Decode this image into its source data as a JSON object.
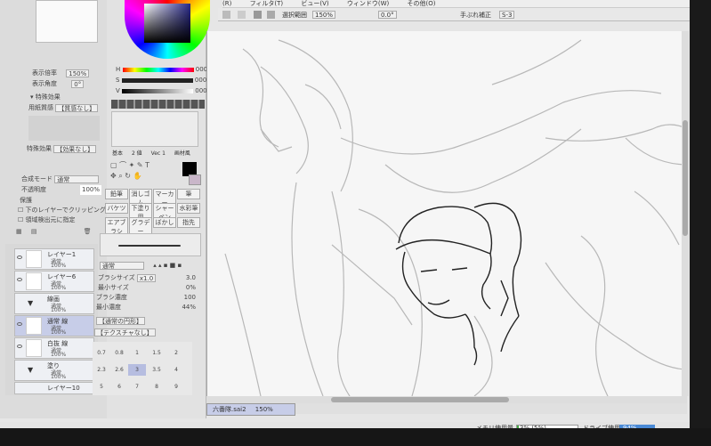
{
  "menu": {
    "items": [
      "フィルタ(T)",
      "ビュー(V)",
      "ウィンドウ(W)",
      "その他(O)"
    ],
    "partial_left": "(R)"
  },
  "toolbar": {
    "selection_label": "選択範囲",
    "zoom": "150%",
    "angle": "0.0°",
    "stabilizer_label": "手ぶれ補正",
    "stabilizer_value": "S-3"
  },
  "navigator": {
    "zoom_label": "表示倍率",
    "zoom_value": "150%",
    "angle_label": "表示角度",
    "angle_value": "0°"
  },
  "color": {
    "h_label": "H",
    "s_label": "S",
    "v_label": "V",
    "h_value": "000",
    "s_value": "000",
    "v_value": "000",
    "accent": "#2a2a8a"
  },
  "layer_props": {
    "paper_section": "特殊効果",
    "paper_label": "用紙質感",
    "paper_value": "【質感なし】",
    "effect_label": "特殊効果",
    "effect_value": "【効果なし】",
    "blend_label": "合成モード",
    "blend_value": "通常",
    "opacity_label": "不透明度",
    "opacity_value": "100%",
    "protect_label": "保護",
    "clip_label": "下のレイヤーでクリッピング",
    "detect_label": "領域検出元に指定"
  },
  "tool_tabs": [
    "基本",
    "2 値",
    "Vec 1",
    "画材風"
  ],
  "tools": [
    "鉛筆",
    "消しゴム",
    "マーカー",
    "筆",
    "バケツ",
    "下塗り用",
    "シャーペン",
    "水彩筆",
    "エアブラシ",
    "グラデー",
    "ぼかし",
    "指先"
  ],
  "brush": {
    "mode": "通常",
    "size_label": "ブラシサイズ",
    "size_mult": "x1.0",
    "size_value": "3.0",
    "min_size_label": "最小サイズ",
    "min_size_value": "0%",
    "density_label": "ブラシ濃度",
    "density_value": "100",
    "min_density_label": "最小濃度",
    "min_density_value": "44%",
    "shape_value": "【通常の円形】",
    "texture_value": "【テクスチャなし】"
  },
  "size_grid": [
    "0.7",
    "0.8",
    "1",
    "1.5",
    "2",
    "2.3",
    "2.6",
    "3",
    "3.5",
    "4",
    "5",
    "6",
    "7",
    "8",
    "9"
  ],
  "layers": [
    {
      "name": "レイヤー1",
      "mode": "通常",
      "opacity": "100%"
    },
    {
      "name": "レイヤー6",
      "mode": "通常",
      "opacity": "100%"
    },
    {
      "name": "線画",
      "mode": "通常",
      "opacity": "100%"
    },
    {
      "name": "通常 線",
      "mode": "通常",
      "opacity": "100%"
    },
    {
      "name": "白抜 線",
      "mode": "通常",
      "opacity": "100%"
    },
    {
      "name": "塗り",
      "mode": "通常",
      "opacity": "100%"
    },
    {
      "name": "レイヤー10",
      "mode": "",
      "opacity": ""
    }
  ],
  "document": {
    "tab_name": "六番隊.sai2",
    "tab_zoom": "150%"
  },
  "status": {
    "memory_label": "メモリ使用量",
    "memory_value": "3% (5%)",
    "drive_label": "ドライブ使用量",
    "drive_value": "94%"
  }
}
